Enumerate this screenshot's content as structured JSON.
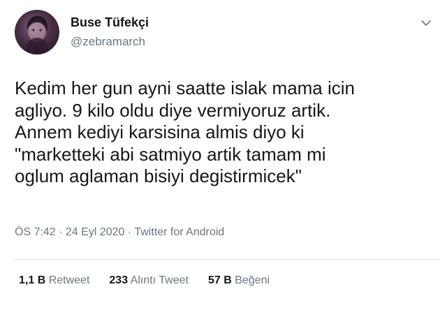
{
  "author": {
    "display_name": "Buse Tüfekçi",
    "handle": "@zebramarch"
  },
  "tweet": {
    "text": "Kedim her gun ayni saatte islak mama icin\nagliyo. 9 kilo oldu diye vermiyoruz artik.\nAnnem kediyi karsisina almis diyo ki\n\"marketteki abi satmiyo artik tamam mi\noglum aglaman bisiyi degistirmicek\"",
    "meta": "ÖS 7:42 · 24 Eyl 2020 · Twitter for Android"
  },
  "stats": {
    "retweets": {
      "count": "1,1 B",
      "label": "Retweet"
    },
    "quotes": {
      "count": "233",
      "label": "Alıntı Tweet"
    },
    "likes": {
      "count": "57 B",
      "label": "Beğeni"
    }
  },
  "icons": {
    "more": "chevron-down-icon"
  },
  "colors": {
    "primary_text": "#14171a",
    "secondary_text": "#657786",
    "divider": "#e1e8ed"
  }
}
